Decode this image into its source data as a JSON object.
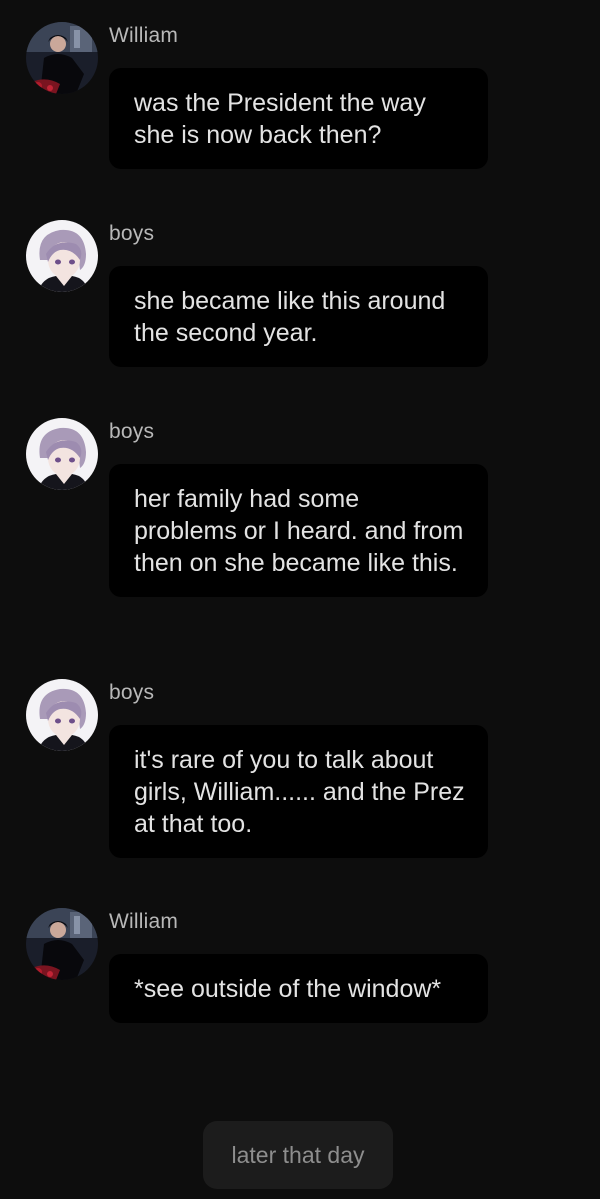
{
  "messages": [
    {
      "name": "William",
      "avatar": "william-avatar-icon",
      "text": "was the President the way she is now back then?"
    },
    {
      "name": "boys",
      "avatar": "boys-avatar-icon",
      "text": "she became like this around the second year."
    },
    {
      "name": "boys",
      "avatar": "boys-avatar-icon",
      "text": "her family had some problems or I heard. and from then on she became like this."
    },
    {
      "name": "boys",
      "avatar": "boys-avatar-icon",
      "text": "it's rare of you to talk about girls, William...... and the Prez at that too."
    },
    {
      "name": "William",
      "avatar": "william-avatar-icon",
      "text": "*see outside of the window*"
    }
  ],
  "narration": {
    "text": "later that day"
  },
  "colors": {
    "background": "#0d0d0d",
    "bubble": "#000000",
    "narration_bg": "#1c1c1c"
  }
}
